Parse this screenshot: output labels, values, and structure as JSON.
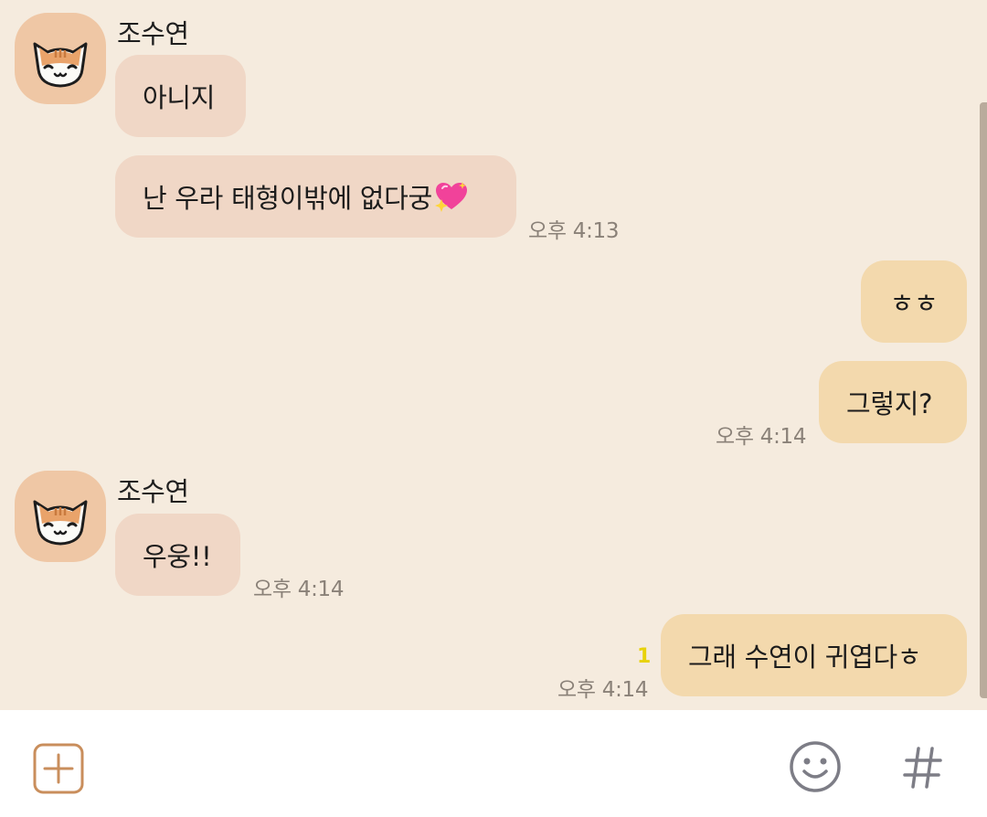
{
  "messages": {
    "m1": {
      "sender": "조수연",
      "text": "아니지"
    },
    "m2": {
      "text": "난 우라 태형이밖에 없다궁",
      "emoji": "sparkling-heart-icon",
      "time": "오후 4:13"
    },
    "m3": {
      "text": "ㅎㅎ"
    },
    "m4": {
      "text": "그렇지?",
      "time": "오후 4:14"
    },
    "m5": {
      "sender": "조수연",
      "text": "우웅!!",
      "time": "오후 4:14"
    },
    "m6": {
      "text": "그래 수연이 귀엽다ㅎ",
      "time": "오후 4:14",
      "unread": "1"
    }
  },
  "input_bar": {
    "attach_icon": "plus-square-icon",
    "emoji_icon": "smiley-icon",
    "hashtag_icon": "hash-icon"
  },
  "colors": {
    "chat_background": "#f5ebde",
    "incoming_bubble": "#f0d7c6",
    "outgoing_bubble": "#f3d9ad",
    "avatar_background": "#efc7a5",
    "unread_count": "#e8d20a"
  }
}
